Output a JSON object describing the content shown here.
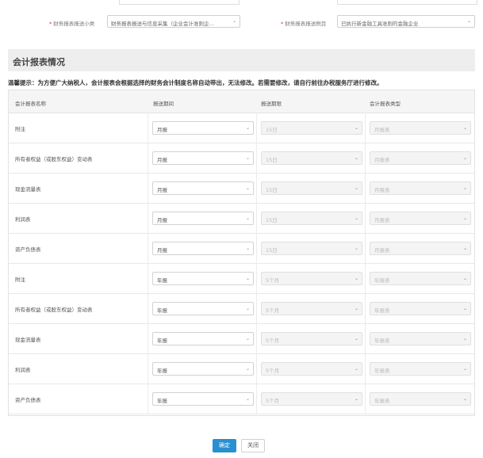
{
  "filters": [
    {
      "label": "财务报表报送小类",
      "value": "财务报表报送与信息采集（企业会计准则企…"
    },
    {
      "label": "财务报表报送税目",
      "value": "已执行新金融工具准则的金融企业"
    }
  ],
  "section": {
    "title": "会计报表情况"
  },
  "tip": "温馨提示：为方便广大纳税人，会计报表会根据选择的财务会计制度名称自动带出，无法修改。若需要修改，请自行前往办税服务厅进行修改。",
  "table": {
    "headers": [
      "会计报表名称",
      "报送期间",
      "报送期限",
      "会计报表类型"
    ],
    "rows": [
      {
        "name": "附注",
        "period": "月报",
        "deadline": "15日",
        "type": "月报表"
      },
      {
        "name": "所有者权益（或股东权益）变动表",
        "period": "月报",
        "deadline": "15日",
        "type": "月报表"
      },
      {
        "name": "现金流量表",
        "period": "月报",
        "deadline": "15日",
        "type": "月报表"
      },
      {
        "name": "利润表",
        "period": "月报",
        "deadline": "15日",
        "type": "月报表"
      },
      {
        "name": "资产负债表",
        "period": "月报",
        "deadline": "15日",
        "type": "月报表"
      },
      {
        "name": "附注",
        "period": "年报",
        "deadline": "5个月",
        "type": "年报表"
      },
      {
        "name": "所有者权益（或股东权益）变动表",
        "period": "年报",
        "deadline": "5个月",
        "type": "年报表"
      },
      {
        "name": "现金流量表",
        "period": "年报",
        "deadline": "5个月",
        "type": "年报表"
      },
      {
        "name": "利润表",
        "period": "年报",
        "deadline": "5个月",
        "type": "年报表"
      },
      {
        "name": "资产负债表",
        "period": "年报",
        "deadline": "5个月",
        "type": "年报表"
      }
    ]
  },
  "buttons": {
    "confirm": "确定",
    "close": "关闭"
  },
  "icons": {
    "dropdown": "chevron-down-icon"
  }
}
